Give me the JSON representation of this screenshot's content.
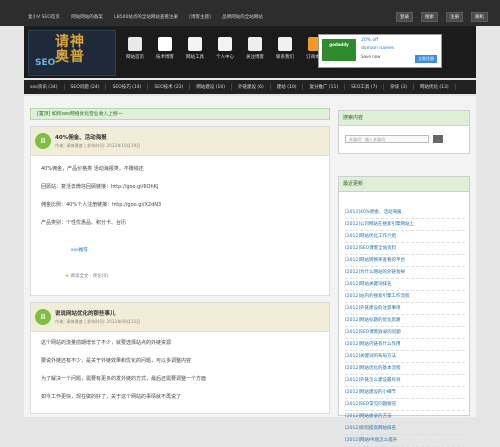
{
  "topbar": {
    "links": [
      "复小V SEO首页",
      "网站网站的备案",
      "LB500站点的全站网站查看注册",
      "[博客主题]",
      "品牌网站的全站网站"
    ],
    "buttons": [
      "登录",
      "搜索",
      "注册",
      "随机"
    ]
  },
  "logo": {
    "text_line1": "请神",
    "text_line2": "奥普",
    "text_seo": "SEO"
  },
  "nav": {
    "items": [
      {
        "label": "网站首页",
        "icon": "home-icon",
        "color": "#e9e9e9"
      },
      {
        "label": "技术博客",
        "icon": "doc-icon",
        "color": "#ffffff"
      },
      {
        "label": "网站工具",
        "icon": "tools-icon",
        "color": "#f3f3f3"
      },
      {
        "label": "个人中心",
        "icon": "user-icon",
        "color": "#f3f3f3"
      },
      {
        "label": "关注博客",
        "icon": "star-icon",
        "color": "#eeeeee"
      },
      {
        "label": "联系我们",
        "icon": "mail-icon",
        "color": "#f0f0f0"
      },
      {
        "label": "订阅本站",
        "icon": "rss-icon",
        "color": "#f39a26"
      }
    ]
  },
  "ad": {
    "logo": "godaddy",
    "line1": "20% off",
    "line2": "domain names",
    "line3": "Save now",
    "button": "立即注册"
  },
  "categories": [
    "seo资讯 (34)",
    "SEO问题 (24)",
    "SEO技巧 (14)",
    "SEO技术 (23)",
    "网站建设 (10)",
    "外链建设 (6)",
    "建站 (10)",
    "复分推广 (11)",
    "SEO工具 (7)",
    "杂谈 (3)",
    "网站优化 (13)",
    "SEO赚钱 (32)"
  ],
  "breadcrumb": "[置顶] 如何seo网络优化营业收入上榜一",
  "posts": [
    {
      "title": "40%佣金、活动海报",
      "meta": "作者: 请神奥普 | 发布时间: 2012年10月19日",
      "lines": [
        "40%佣金，产品价格类 活动海报类，不赚钱还",
        "回顾站：复活去微信回顾链接：http://goo.gl/6OhKj",
        "佣金比例：40%个人注册链接：http://goo.gl/X2dN3",
        "产品类别：个性优惠品、积分卡、台历"
      ],
      "tags": "seo推荐",
      "foot": "阅读全文 · 评论(0)"
    },
    {
      "title": "说说网站优化的那些事儿",
      "meta": "作者: 请神奥普 | 发布时间: 2012年09月15日",
      "lines": [
        "这个网站的流量前期增长了不少，就要选择站点的外链资源",
        "要说外链还有不少，是关于外链效果和优化的问题，可以多调整内容",
        "为了解决一个问题，需要有更多的发外链的方式，最后还需要调整一个方面",
        "如今工作更快，现在做的好了，关于这个网站的事情就不再说了"
      ],
      "tags": "",
      "foot": ""
    }
  ],
  "side": {
    "search_title": "搜索内容",
    "search_placeholder": "关键词：输入关键词",
    "recent_title": "最近更新",
    "recent": [
      "[2013]40%佣金、活动海报",
      "[2012]公司网站在搜索引擎网站上",
      "[2012]网站优化工作介绍",
      "[2012]SEO博客全站资料",
      "[2012]网站转换率查看的平台",
      "[2012]为什么网站的外链会掉",
      "[2012]网站关键词排名",
      "[2012]站内的搜索引擎工作流程",
      "[2012]外链建设的注意事项",
      "[2012]网站标题的优化思路",
      "[2012]SEO博客收录的问题",
      "[2012]网站内链有什么作用",
      "[2012]关键词的布局方法",
      "[2012]网站优化的基本流程",
      "[2012]外链怎么建设最有效",
      "[2012]网站建设的小细节",
      "[2012]SEO常见问题解答",
      "[2012]网站收录的方法",
      "[2012]如何提高网站排名",
      "[2012]网站PR值怎么提升"
    ]
  }
}
